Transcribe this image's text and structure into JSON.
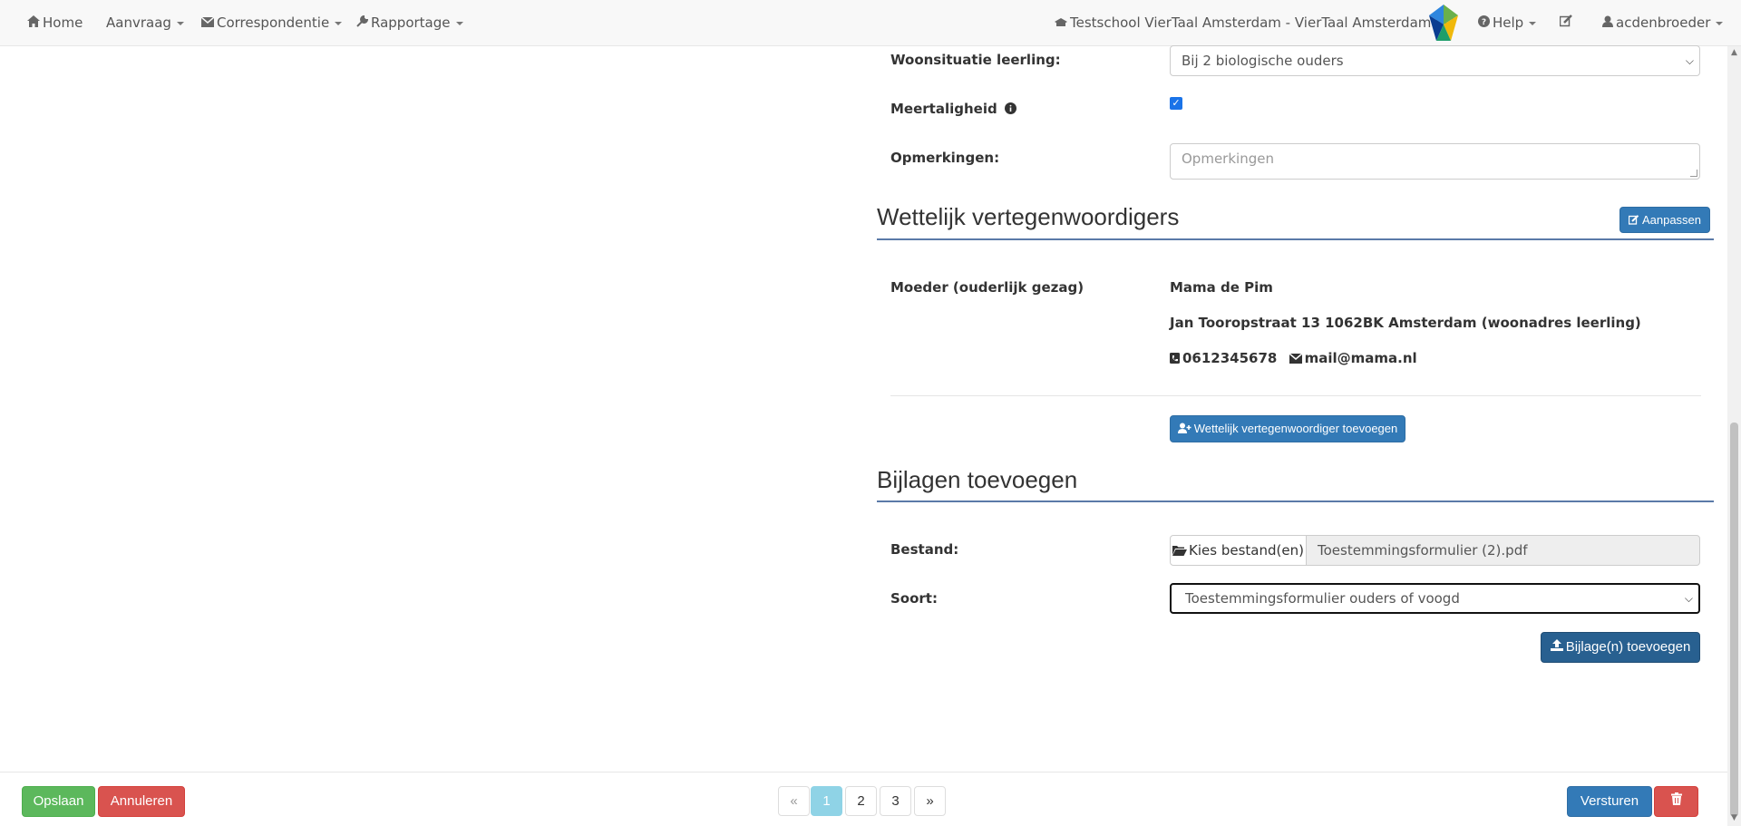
{
  "nav": {
    "home": "Home",
    "aanvraag": "Aanvraag",
    "correspondentie": "Correspondentie",
    "rapportage": "Rapportage",
    "school": "Testschool VierTaal Amsterdam - VierTaal Amsterdam SO",
    "help": "Help",
    "user": "acdenbroeder"
  },
  "form": {
    "woonsituatie_label": "Woonsituatie leerling:",
    "woonsituatie_value": "Bij 2 biologische ouders",
    "meertaligheid_label": "Meertaligheid",
    "meertaligheid_checked": true,
    "opmerkingen_label": "Opmerkingen:",
    "opmerkingen_placeholder": "Opmerkingen"
  },
  "representatives": {
    "title": "Wettelijk vertegenwoordigers",
    "edit_button": "Aanpassen",
    "relation": "Moeder (ouderlijk gezag)",
    "name": "Mama de Pim",
    "address": "Jan Tooropstraat 13 1062BK Amsterdam (woonadres leerling)",
    "phone": "0612345678",
    "email": "mail@mama.nl",
    "add_button": "Wettelijk vertegenwoordiger toevoegen"
  },
  "attachments": {
    "title": "Bijlagen toevoegen",
    "file_label": "Bestand:",
    "choose_button": "Kies bestand(en)",
    "file_name": "Toestemmingsformulier (2).pdf",
    "type_label": "Soort:",
    "type_value": "Toestemmingsformulier ouders of voogd",
    "add_button": "Bijlage(n) toevoegen"
  },
  "footer": {
    "save": "Opslaan",
    "cancel": "Annuleren",
    "pages": [
      "«",
      "1",
      "2",
      "3",
      "»"
    ],
    "current_page": "1",
    "send": "Versturen"
  },
  "colors": {
    "primary": "#337ab7",
    "success": "#5cb85c",
    "danger": "#d9534f",
    "active_page": "#8fd3e6"
  }
}
